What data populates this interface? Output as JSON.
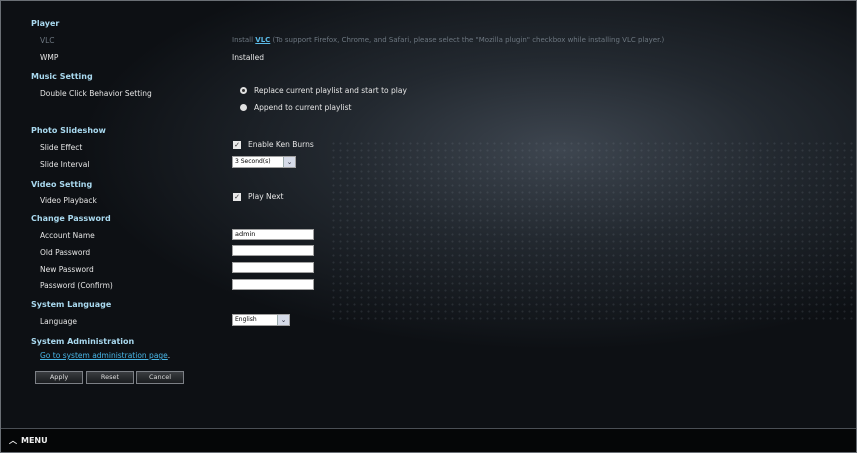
{
  "player": {
    "title": "Player",
    "vlc_label": "VLC",
    "vlc_prefix": "Install ",
    "vlc_link": "VLC",
    "vlc_suffix": " (To support Firefox, Chrome, and Safari, please select the \"Mozilla plugin\" checkbox while installing VLC player.)",
    "wmp_label": "WMP",
    "wmp_value": "Installed"
  },
  "music": {
    "title": "Music Setting",
    "dbl_click_label": "Double Click Behavior Setting",
    "option_replace": "Replace current playlist and start to play",
    "option_append": "Append to current playlist"
  },
  "photo": {
    "title": "Photo Slideshow",
    "effect_label": "Slide Effect",
    "effect_option": "Enable Ken Burns",
    "interval_label": "Slide Interval",
    "interval_value": "3 Second(s)"
  },
  "video": {
    "title": "Video Setting",
    "playback_label": "Video Playback",
    "playback_option": "Play Next"
  },
  "password": {
    "title": "Change Password",
    "account_label": "Account Name",
    "account_value": "admin",
    "old_label": "Old Password",
    "new_label": "New Password",
    "confirm_label": "Password (Confirm)"
  },
  "language": {
    "title": "System Language",
    "label": "Language",
    "value": "English"
  },
  "admin": {
    "title": "System Administration",
    "link": "Go to system administration page",
    "link_suffix": "."
  },
  "buttons": {
    "apply": "Apply",
    "reset": "Reset",
    "cancel": "Cancel"
  },
  "menu": {
    "label": "MENU"
  },
  "icons": {
    "menu": "chevron-up-icon",
    "dropdown": "chevron-down-icon",
    "check": "check-icon"
  },
  "colors": {
    "section_title": "#a9d9ef",
    "link": "#49b6e6"
  }
}
